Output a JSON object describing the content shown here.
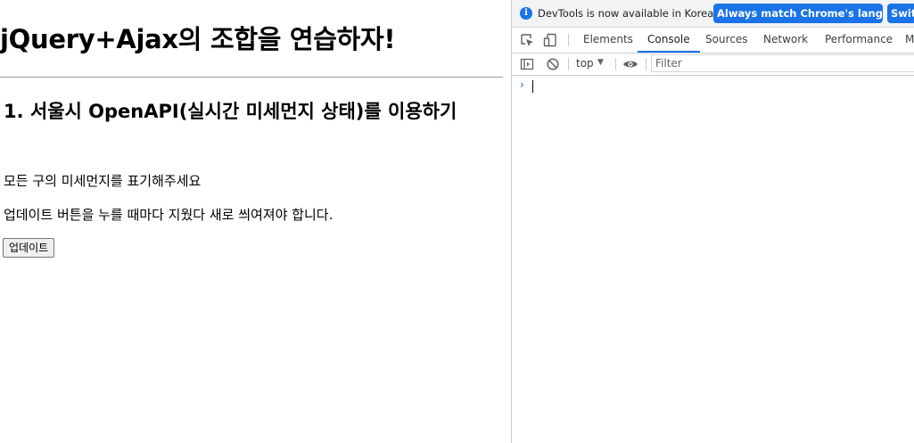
{
  "page": {
    "title": "jQuery+Ajax의 조합을 연습하자!",
    "section_title": "1. 서울시 OpenAPI(실시간 미세먼지 상태)를 이용하기",
    "paragraphs": [
      "모든 구의 미세먼지를 표기해주세요",
      "업데이트 버튼을 누를 때마다 지웠다 새로 씌여져야 합니다."
    ],
    "update_button": "업데이트"
  },
  "devtools": {
    "infobar": {
      "icon": "info-icon",
      "message": "DevTools is now available in Korean!",
      "match_button": "Always match Chrome's language",
      "switch_button": "Switch"
    },
    "toolbar_icons": [
      "inspect-element-icon",
      "device-toolbar-icon"
    ],
    "tabs": [
      {
        "label": "Elements",
        "active": false
      },
      {
        "label": "Console",
        "active": true
      },
      {
        "label": "Sources",
        "active": false
      },
      {
        "label": "Network",
        "active": false
      },
      {
        "label": "Performance",
        "active": false
      },
      {
        "label": "M",
        "active": false
      }
    ],
    "console_toolbar": {
      "context": "top",
      "filter_placeholder": "Filter",
      "icons": [
        "sidebar-toggle-icon",
        "clear-console-icon",
        "eye-icon"
      ]
    },
    "console": {
      "prompt": "›"
    }
  },
  "colors": {
    "accent": "#1a73e8",
    "infobar_bg": "#f1f3f4",
    "divider": "#cacdd1"
  }
}
